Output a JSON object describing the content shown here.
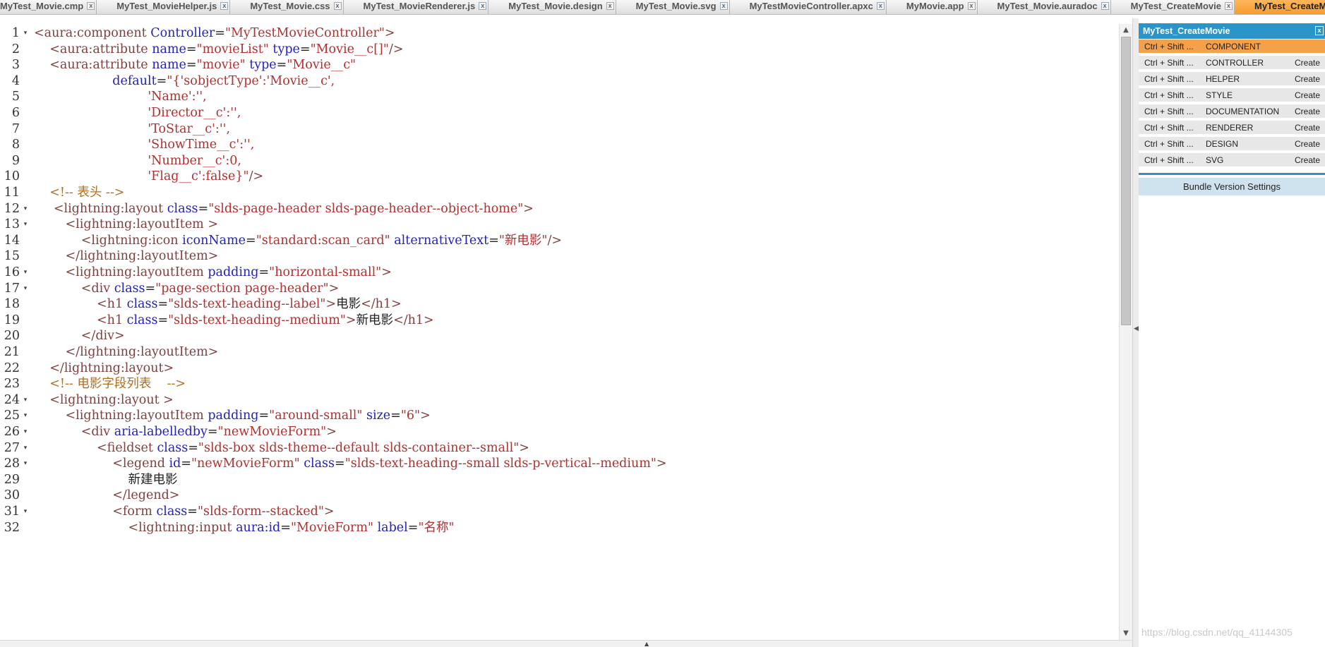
{
  "tabs": [
    "MyTest_Movie.cmp",
    "MyTest_MovieHelper.js",
    "MyTest_Movie.css",
    "MyTest_MovieRenderer.js",
    "MyTest_Movie.design",
    "MyTest_Movie.svg",
    "MyTestMovieController.apxc",
    "MyMovie.app",
    "MyTest_Movie.auradoc",
    "MyTest_CreateMovie",
    "MyTest_CreateMovie.cmp"
  ],
  "tab_close_glyph": "x",
  "editor": {
    "lines": [
      {
        "n": "1",
        "fold": "▾",
        "code": [
          [
            "t",
            "<aura:component "
          ],
          [
            "a",
            "Controller"
          ],
          [
            "x",
            "="
          ],
          [
            "s",
            "\"MyTestMovieController\""
          ],
          [
            "t",
            ">"
          ]
        ]
      },
      {
        "n": "2",
        "fold": "",
        "code": [
          [
            "x",
            "    "
          ],
          [
            "t",
            "<aura:attribute "
          ],
          [
            "a",
            "name"
          ],
          [
            "x",
            "="
          ],
          [
            "s",
            "\"movieList\" "
          ],
          [
            "a",
            "type"
          ],
          [
            "x",
            "="
          ],
          [
            "s",
            "\"Movie__c[]\""
          ],
          [
            "t",
            "/>"
          ]
        ]
      },
      {
        "n": "3",
        "fold": "",
        "code": [
          [
            "x",
            "    "
          ],
          [
            "t",
            "<aura:attribute "
          ],
          [
            "a",
            "name"
          ],
          [
            "x",
            "="
          ],
          [
            "s",
            "\"movie\" "
          ],
          [
            "a",
            "type"
          ],
          [
            "x",
            "="
          ],
          [
            "s",
            "\"Movie__c\""
          ]
        ]
      },
      {
        "n": "4",
        "fold": "",
        "code": [
          [
            "x",
            "                    "
          ],
          [
            "a",
            "default"
          ],
          [
            "x",
            "="
          ],
          [
            "s",
            "\"{'sobjectType':'Movie__c',"
          ]
        ]
      },
      {
        "n": "5",
        "fold": "",
        "code": [
          [
            "x",
            "                             "
          ],
          [
            "s",
            "'Name':'',"
          ]
        ]
      },
      {
        "n": "6",
        "fold": "",
        "code": [
          [
            "x",
            "                             "
          ],
          [
            "s",
            "'Director__c':'',"
          ]
        ]
      },
      {
        "n": "7",
        "fold": "",
        "code": [
          [
            "x",
            "                             "
          ],
          [
            "s",
            "'ToStar__c':'',"
          ]
        ]
      },
      {
        "n": "8",
        "fold": "",
        "code": [
          [
            "x",
            "                             "
          ],
          [
            "s",
            "'ShowTime__c':'',"
          ]
        ]
      },
      {
        "n": "9",
        "fold": "",
        "code": [
          [
            "x",
            "                             "
          ],
          [
            "s",
            "'Number__c':0,"
          ]
        ]
      },
      {
        "n": "10",
        "fold": "",
        "code": [
          [
            "x",
            "                             "
          ],
          [
            "s",
            "'Flag__c':false}\""
          ],
          [
            "t",
            "/>"
          ]
        ]
      },
      {
        "n": "11",
        "fold": "",
        "code": [
          [
            "x",
            "    "
          ],
          [
            "c",
            "<!-- 表头 -->"
          ]
        ]
      },
      {
        "n": "12",
        "fold": "▾",
        "code": [
          [
            "x",
            "     "
          ],
          [
            "t",
            "<lightning:layout "
          ],
          [
            "a",
            "class"
          ],
          [
            "x",
            "="
          ],
          [
            "s",
            "\"slds-page-header slds-page-header--object-home\""
          ],
          [
            "t",
            ">"
          ]
        ]
      },
      {
        "n": "13",
        "fold": "▾",
        "code": [
          [
            "x",
            "        "
          ],
          [
            "t",
            "<lightning:layoutItem >"
          ]
        ]
      },
      {
        "n": "14",
        "fold": "",
        "code": [
          [
            "x",
            "            "
          ],
          [
            "t",
            "<lightning:icon "
          ],
          [
            "a",
            "iconName"
          ],
          [
            "x",
            "="
          ],
          [
            "s",
            "\"standard:scan_card\" "
          ],
          [
            "a",
            "alternativeText"
          ],
          [
            "x",
            "="
          ],
          [
            "s",
            "\"新电影\""
          ],
          [
            "t",
            "/>"
          ]
        ]
      },
      {
        "n": "15",
        "fold": "",
        "code": [
          [
            "x",
            "        "
          ],
          [
            "t",
            "</lightning:layoutItem>"
          ]
        ]
      },
      {
        "n": "16",
        "fold": "▾",
        "code": [
          [
            "x",
            "        "
          ],
          [
            "t",
            "<lightning:layoutItem "
          ],
          [
            "a",
            "padding"
          ],
          [
            "x",
            "="
          ],
          [
            "s",
            "\"horizontal-small\""
          ],
          [
            "t",
            ">"
          ]
        ]
      },
      {
        "n": "17",
        "fold": "▾",
        "code": [
          [
            "x",
            "            "
          ],
          [
            "t",
            "<div "
          ],
          [
            "a",
            "class"
          ],
          [
            "x",
            "="
          ],
          [
            "s",
            "\"page-section page-header\""
          ],
          [
            "t",
            ">"
          ]
        ]
      },
      {
        "n": "18",
        "fold": "",
        "code": [
          [
            "x",
            "                "
          ],
          [
            "t",
            "<h1 "
          ],
          [
            "a",
            "class"
          ],
          [
            "x",
            "="
          ],
          [
            "s",
            "\"slds-text-heading--label\""
          ],
          [
            "t",
            ">"
          ],
          [
            "x",
            "电影"
          ],
          [
            "t",
            "</h1>"
          ]
        ]
      },
      {
        "n": "19",
        "fold": "",
        "code": [
          [
            "x",
            "                "
          ],
          [
            "t",
            "<h1 "
          ],
          [
            "a",
            "class"
          ],
          [
            "x",
            "="
          ],
          [
            "s",
            "\"slds-text-heading--medium\""
          ],
          [
            "t",
            ">"
          ],
          [
            "x",
            "新电影"
          ],
          [
            "t",
            "</h1>"
          ]
        ]
      },
      {
        "n": "20",
        "fold": "",
        "code": [
          [
            "x",
            "            "
          ],
          [
            "t",
            "</div>"
          ]
        ]
      },
      {
        "n": "21",
        "fold": "",
        "code": [
          [
            "x",
            "        "
          ],
          [
            "t",
            "</lightning:layoutItem>"
          ]
        ]
      },
      {
        "n": "22",
        "fold": "",
        "code": [
          [
            "x",
            "    "
          ],
          [
            "t",
            "</lightning:layout>"
          ]
        ]
      },
      {
        "n": "23",
        "fold": "",
        "code": [
          [
            "x",
            "    "
          ],
          [
            "c",
            "<!-- 电影字段列表    -->"
          ]
        ]
      },
      {
        "n": "24",
        "fold": "▾",
        "code": [
          [
            "x",
            "    "
          ],
          [
            "t",
            "<lightning:layout >"
          ]
        ]
      },
      {
        "n": "25",
        "fold": "▾",
        "code": [
          [
            "x",
            "        "
          ],
          [
            "t",
            "<lightning:layoutItem "
          ],
          [
            "a",
            "padding"
          ],
          [
            "x",
            "="
          ],
          [
            "s",
            "\"around-small\" "
          ],
          [
            "a",
            "size"
          ],
          [
            "x",
            "="
          ],
          [
            "s",
            "\"6\""
          ],
          [
            "t",
            ">"
          ]
        ]
      },
      {
        "n": "26",
        "fold": "▾",
        "code": [
          [
            "x",
            "            "
          ],
          [
            "t",
            "<div "
          ],
          [
            "a",
            "aria-labelledby"
          ],
          [
            "x",
            "="
          ],
          [
            "s",
            "\"newMovieForm\""
          ],
          [
            "t",
            ">"
          ]
        ]
      },
      {
        "n": "27",
        "fold": "▾",
        "code": [
          [
            "x",
            "                "
          ],
          [
            "t",
            "<fieldset "
          ],
          [
            "a",
            "class"
          ],
          [
            "x",
            "="
          ],
          [
            "s",
            "\"slds-box slds-theme--default slds-container--small\""
          ],
          [
            "t",
            ">"
          ]
        ]
      },
      {
        "n": "28",
        "fold": "▾",
        "code": [
          [
            "x",
            "                    "
          ],
          [
            "t",
            "<legend "
          ],
          [
            "a",
            "id"
          ],
          [
            "x",
            "="
          ],
          [
            "s",
            "\"newMovieForm\" "
          ],
          [
            "a",
            "class"
          ],
          [
            "x",
            "="
          ],
          [
            "s",
            "\"slds-text-heading--small slds-p-vertical--medium\""
          ],
          [
            "t",
            ">"
          ]
        ]
      },
      {
        "n": "29",
        "fold": "",
        "code": [
          [
            "x",
            "                        新建电影"
          ]
        ]
      },
      {
        "n": "30",
        "fold": "",
        "code": [
          [
            "x",
            "                    "
          ],
          [
            "t",
            "</legend>"
          ]
        ]
      },
      {
        "n": "31",
        "fold": "▾",
        "code": [
          [
            "x",
            "                    "
          ],
          [
            "t",
            "<form "
          ],
          [
            "a",
            "class"
          ],
          [
            "x",
            "="
          ],
          [
            "s",
            "\"slds-form--stacked\""
          ],
          [
            "t",
            ">"
          ]
        ]
      },
      {
        "n": "32",
        "fold": "",
        "code": [
          [
            "x",
            "                        "
          ],
          [
            "t",
            "<lightning:input "
          ],
          [
            "a",
            "aura:id"
          ],
          [
            "x",
            "="
          ],
          [
            "s",
            "\"MovieForm\" "
          ],
          [
            "a",
            "label"
          ],
          [
            "x",
            "="
          ],
          [
            "s",
            "\"名称\""
          ]
        ]
      }
    ]
  },
  "panel": {
    "title": "MyTest_CreateMovie",
    "close_glyph": "x",
    "rows": [
      {
        "key": "Ctrl + Shift ...",
        "name": "COMPONENT",
        "action": ""
      },
      {
        "key": "Ctrl + Shift ...",
        "name": "CONTROLLER",
        "action": "Create"
      },
      {
        "key": "Ctrl + Shift ...",
        "name": "HELPER",
        "action": "Create"
      },
      {
        "key": "Ctrl + Shift ...",
        "name": "STYLE",
        "action": "Create"
      },
      {
        "key": "Ctrl + Shift ...",
        "name": "DOCUMENTATION",
        "action": "Create"
      },
      {
        "key": "Ctrl + Shift ...",
        "name": "RENDERER",
        "action": "Create"
      },
      {
        "key": "Ctrl + Shift ...",
        "name": "DESIGN",
        "action": "Create"
      },
      {
        "key": "Ctrl + Shift ...",
        "name": "SVG",
        "action": "Create"
      }
    ],
    "bundle_button": "Bundle Version Settings"
  },
  "watermark": "https://blog.csdn.net/qq_41144305",
  "colors": {
    "active_tab": "#f59a2b",
    "panel_header": "#2b94c8",
    "tag": "#7f3f3f",
    "attribute": "#2222bb",
    "string": "#b03030",
    "comment": "#b06e22"
  },
  "icons": {
    "fold": "chevron-down-icon",
    "scroll_up": "arrow-up-icon",
    "scroll_down": "arrow-down-icon",
    "close": "close-icon"
  }
}
